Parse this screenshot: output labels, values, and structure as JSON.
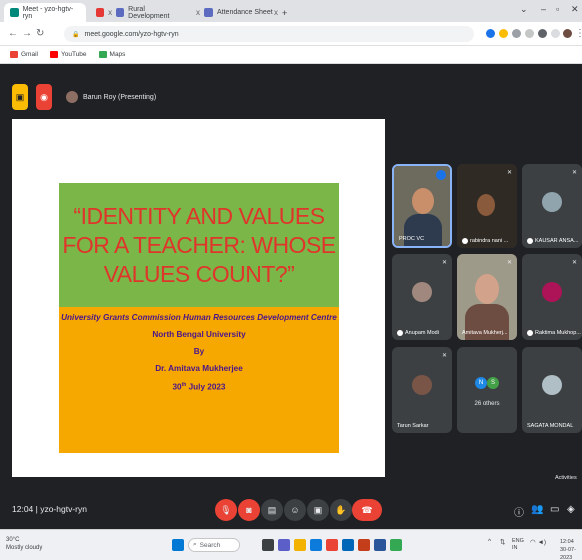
{
  "browser": {
    "tabs": [
      {
        "label": "Meet - yzo-hgtv-ryn"
      },
      {
        "label": "Rural Development"
      },
      {
        "label": "Attendance Sheet"
      }
    ],
    "new_tab": "+",
    "url": "meet.google.com/yzo-hgtv-ryn",
    "bookmarks": [
      {
        "label": "Gmail",
        "icon": "gmail-icon",
        "color": "#ea4335"
      },
      {
        "label": "YouTube",
        "icon": "youtube-icon",
        "color": "#ff0000"
      },
      {
        "label": "Maps",
        "icon": "maps-icon",
        "color": "#34a853"
      }
    ]
  },
  "meet": {
    "presenter_label": "Barun Roy (Presenting)",
    "meeting_code_time": "12:04  |  yzo-hgtv-ryn",
    "activities_label": "Activities"
  },
  "slide": {
    "title": "“IDENTITY AND VALUES FOR A TEACHER: WHOSE VALUES COUNT?”",
    "org": "University Grants Commission Human Resources Development Centre",
    "university": "North Bengal University",
    "by": "By",
    "presenter": "Dr. Amitava Mukherjee",
    "date_day": "30",
    "date_suffix": "th",
    "date_rest": " July 2023"
  },
  "participants": [
    {
      "name": "PROC VC"
    },
    {
      "name": "rabindra nani ..."
    },
    {
      "name": "KAUSAR ANSA..."
    },
    {
      "name": "Anupam Modi"
    },
    {
      "name": "Amitava Mukherj..."
    },
    {
      "name": "Raktima Mukhop..."
    },
    {
      "name": "Tarun Sarkar"
    },
    {
      "name": "26 others"
    },
    {
      "name": "SAGATA MONDAL"
    }
  ],
  "others_avatars": [
    {
      "letter": "N",
      "color": "#1e88e5"
    },
    {
      "letter": "S",
      "color": "#43a047"
    }
  ],
  "taskbar": {
    "weather_temp": "30°C",
    "weather_desc": "Mostly cloudy",
    "search_placeholder": "Search",
    "lang": "ENG",
    "lang_sub": "IN",
    "time": "12:04",
    "date": "30-07-2023"
  },
  "colors": {
    "slide_green": "#7ab648",
    "slide_orange": "#f7a800",
    "slide_title": "#e0352b",
    "slide_text": "#4a148c",
    "meet_bg": "#202124",
    "leave_red": "#ea4335"
  }
}
